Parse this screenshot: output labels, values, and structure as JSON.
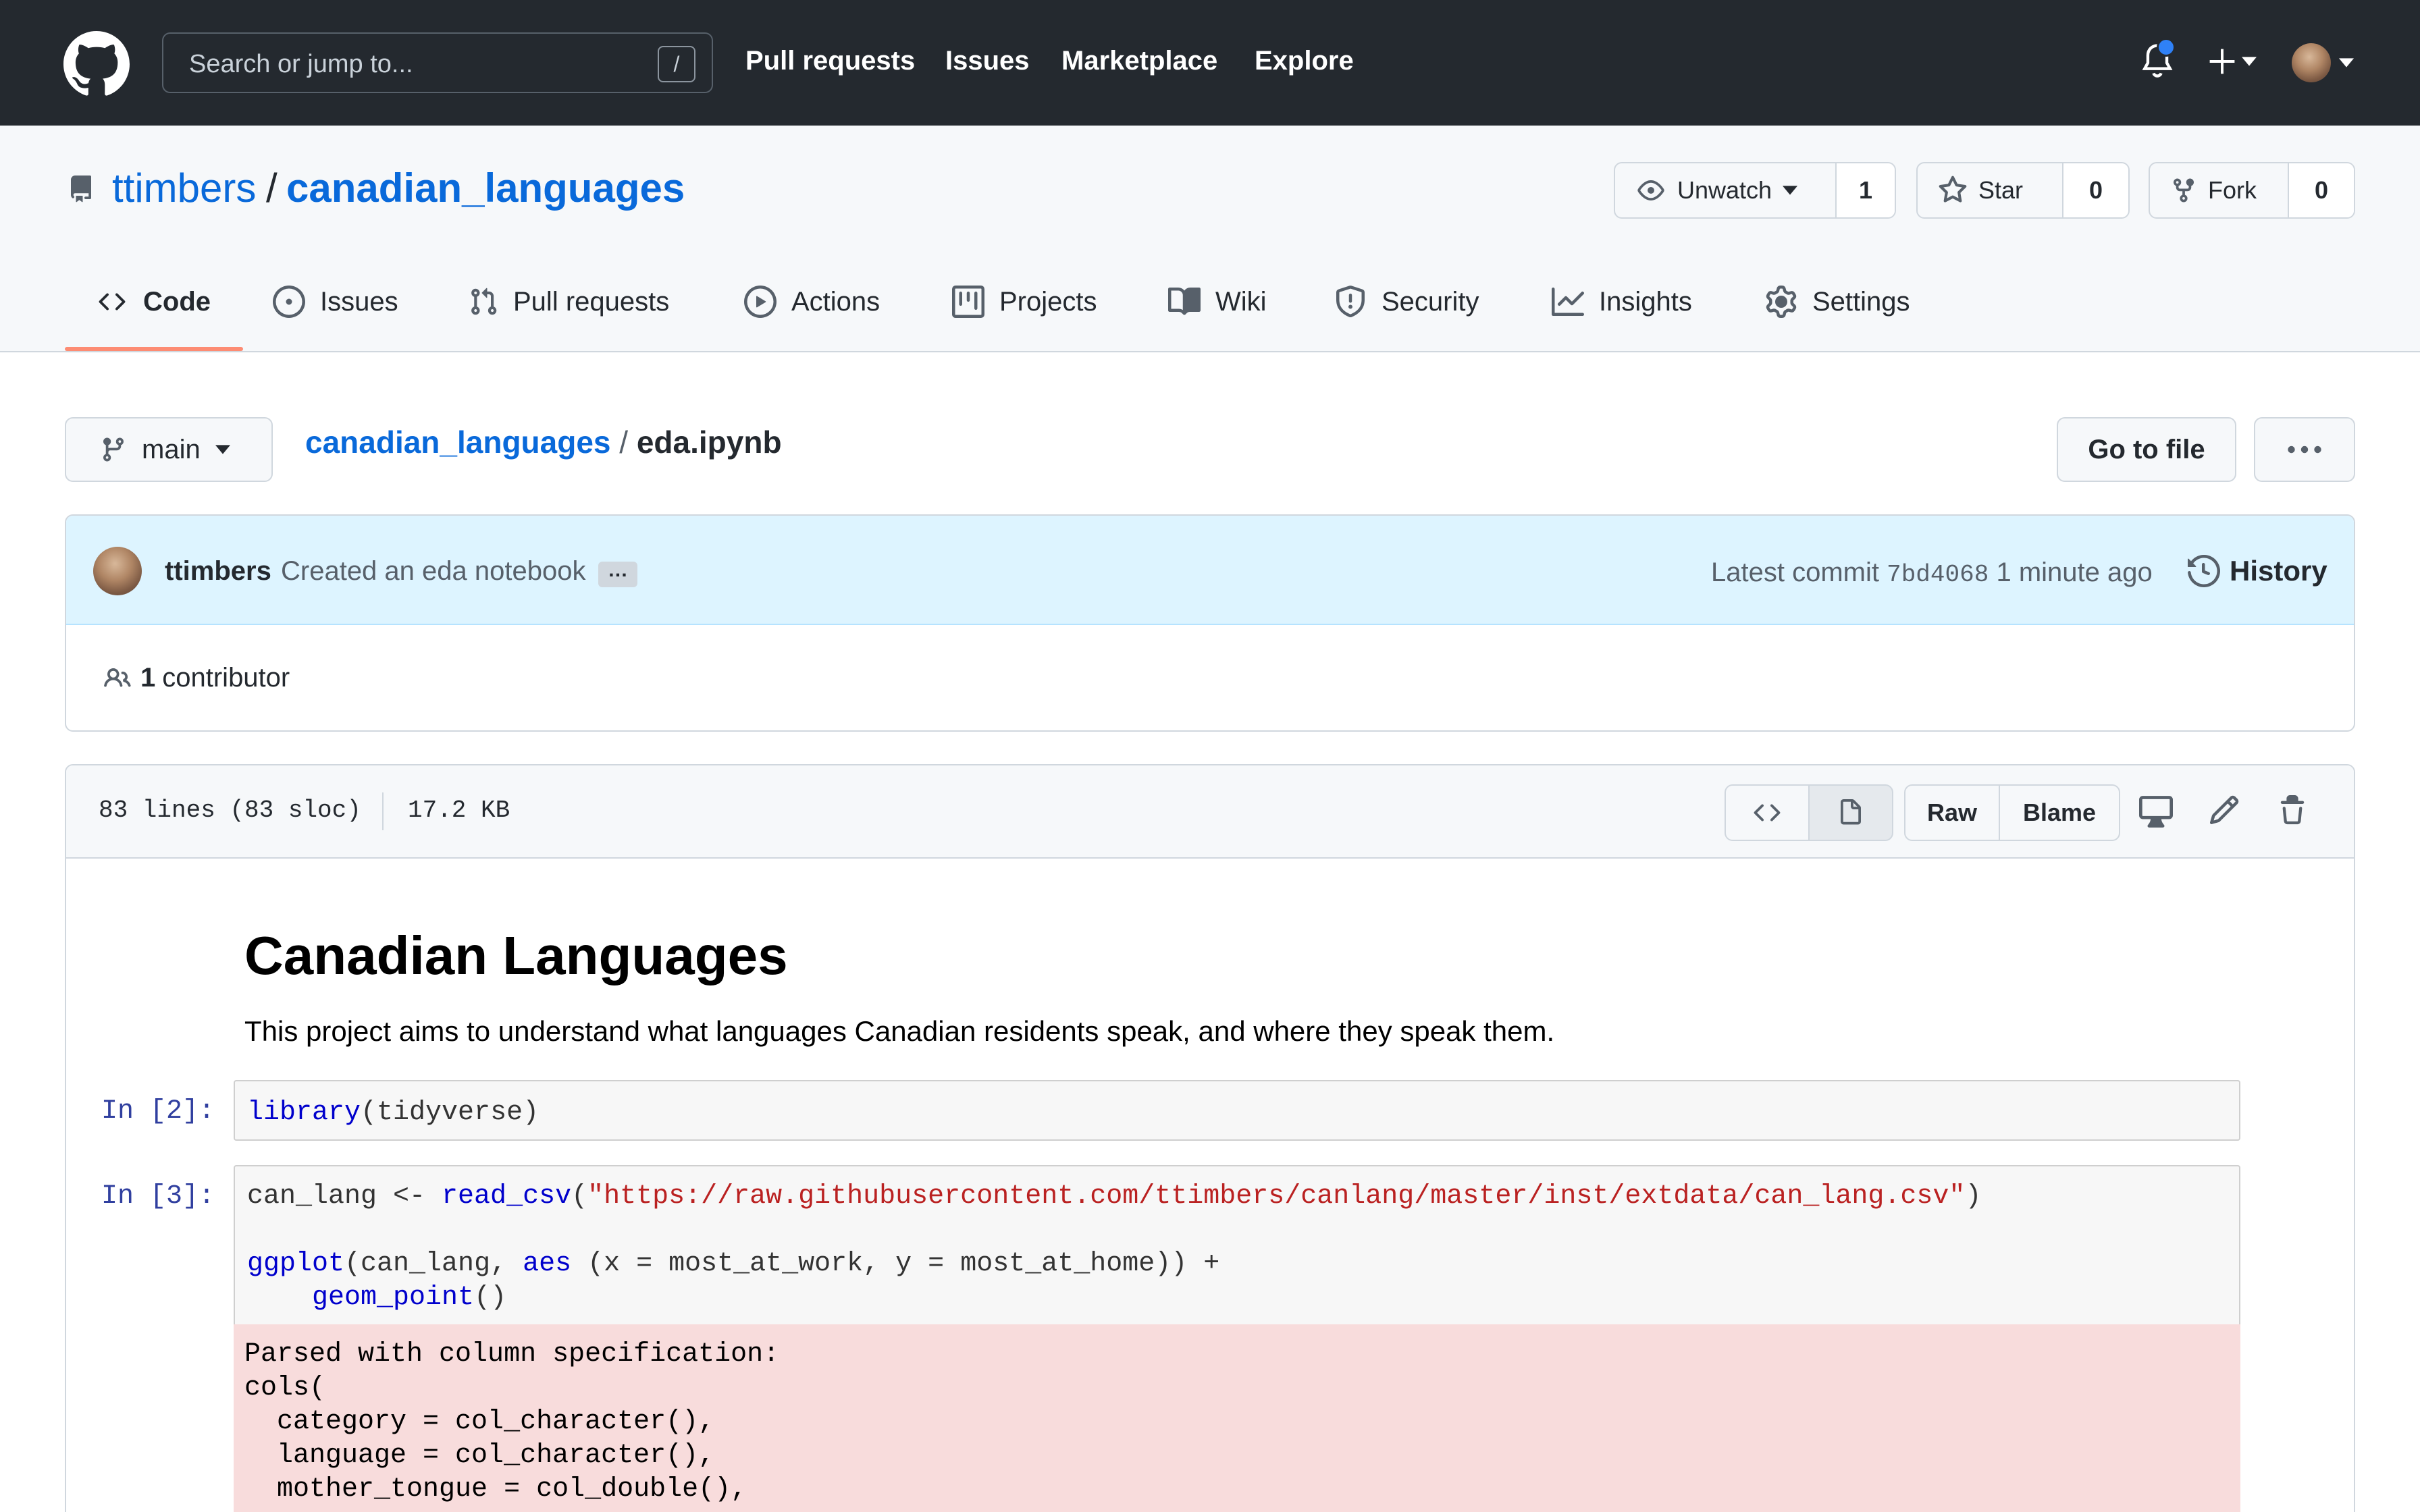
{
  "header": {
    "search_placeholder": "Search or jump to...",
    "search_shortcut": "/",
    "nav": [
      "Pull requests",
      "Issues",
      "Marketplace",
      "Explore"
    ]
  },
  "repo": {
    "owner": "ttimbers",
    "separator": "/",
    "name": "canadian_languages",
    "watch": {
      "label": "Unwatch",
      "count": "1"
    },
    "star": {
      "label": "Star",
      "count": "0"
    },
    "fork": {
      "label": "Fork",
      "count": "0"
    }
  },
  "tabs": [
    "Code",
    "Issues",
    "Pull requests",
    "Actions",
    "Projects",
    "Wiki",
    "Security",
    "Insights",
    "Settings"
  ],
  "active_tab": "Code",
  "file_nav": {
    "branch": "main",
    "crumb_repo": "canadian_languages",
    "crumb_sep": " / ",
    "crumb_file": "eda.ipynb",
    "go_to_file": "Go to file"
  },
  "commit": {
    "author": "ttimbers",
    "message": "Created an eda notebook",
    "ellipsis": "…",
    "latest_label": "Latest commit",
    "sha": "7bd4068",
    "time": "1 minute ago",
    "history": "History",
    "contributors_count": "1",
    "contributors_label": "contributor"
  },
  "file": {
    "lines": "83 lines (83 sloc)",
    "size": "17.2 KB",
    "raw": "Raw",
    "blame": "Blame"
  },
  "notebook": {
    "title": "Canadian Languages",
    "description": "This project aims to understand what languages Canadian residents speak, and where they speak them.",
    "cell1": {
      "prompt": "In [2]:",
      "fn": "library",
      "rest": "(tidyverse)"
    },
    "cell2": {
      "prompt": "In [3]:",
      "l1_var": "can_lang <- ",
      "l1_fn": "read_csv",
      "l1_open": "(",
      "l1_str": "\"https://raw.githubusercontent.com/ttimbers/canlang/master/inst/extdata/can_lang.csv\"",
      "l1_close": ")",
      "l2_fn": "ggplot",
      "l2_mid": "(can_lang, ",
      "l2_fn2": "aes",
      "l2_rest": " (x = most_at_work, y = most_at_home)) +",
      "l3_indent": "    ",
      "l3_fn": "geom_point",
      "l3_rest": "()"
    },
    "output_lines": [
      "Parsed with column specification:",
      "cols(",
      "  category = col_character(),",
      "  language = col_character(),",
      "  mother_tongue = col_double(),"
    ]
  },
  "colors": {
    "header_bg": "#24292f",
    "link": "#0969da",
    "tab_underline": "#fd8c73",
    "notify_dot": "#2f81f7",
    "commit_bg": "#ddf4ff",
    "output_bg": "#f8dcdc"
  },
  "icons": [
    "github-logo-icon",
    "bell-icon",
    "plus-icon",
    "repo-icon",
    "eye-icon",
    "star-icon",
    "fork-icon",
    "code-icon",
    "issue-icon",
    "pull-request-icon",
    "play-icon",
    "project-icon",
    "book-icon",
    "shield-icon",
    "graph-icon",
    "gear-icon",
    "branch-icon",
    "kebab-icon",
    "history-icon",
    "people-icon",
    "file-icon",
    "desktop-icon",
    "pencil-icon",
    "trash-icon"
  ]
}
